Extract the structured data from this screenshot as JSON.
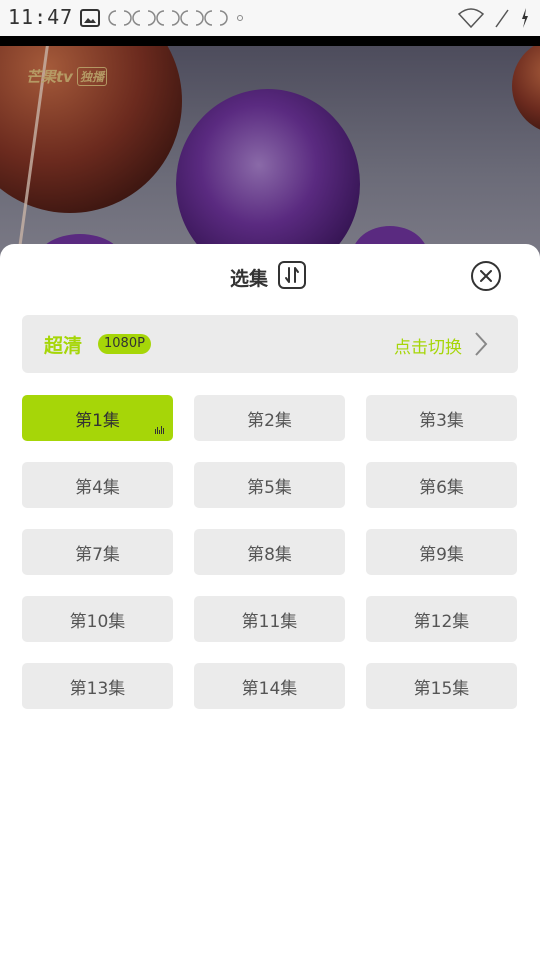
{
  "status_bar": {
    "time": "11:47"
  },
  "video": {
    "watermark_brand": "芒果tv",
    "watermark_badge": "独播"
  },
  "sheet": {
    "title": "选集",
    "quality_name": "超清",
    "quality_badge": "1080P",
    "switch_label": "点击切换"
  },
  "episodes": [
    {
      "label": "第1集",
      "active": true
    },
    {
      "label": "第2集",
      "active": false
    },
    {
      "label": "第3集",
      "active": false
    },
    {
      "label": "第4集",
      "active": false
    },
    {
      "label": "第5集",
      "active": false
    },
    {
      "label": "第6集",
      "active": false
    },
    {
      "label": "第7集",
      "active": false
    },
    {
      "label": "第8集",
      "active": false
    },
    {
      "label": "第9集",
      "active": false
    },
    {
      "label": "第10集",
      "active": false
    },
    {
      "label": "第11集",
      "active": false
    },
    {
      "label": "第12集",
      "active": false
    },
    {
      "label": "第13集",
      "active": false
    },
    {
      "label": "第14集",
      "active": false
    },
    {
      "label": "第15集",
      "active": false
    }
  ],
  "colors": {
    "accent": "#a6d608",
    "tile_bg": "#ebebeb",
    "text": "#333333"
  },
  "icons": {
    "sort": "sort-toggle-icon",
    "close": "close-icon",
    "switch": "chevron-right-icon",
    "playing": "playing-bars-icon"
  }
}
